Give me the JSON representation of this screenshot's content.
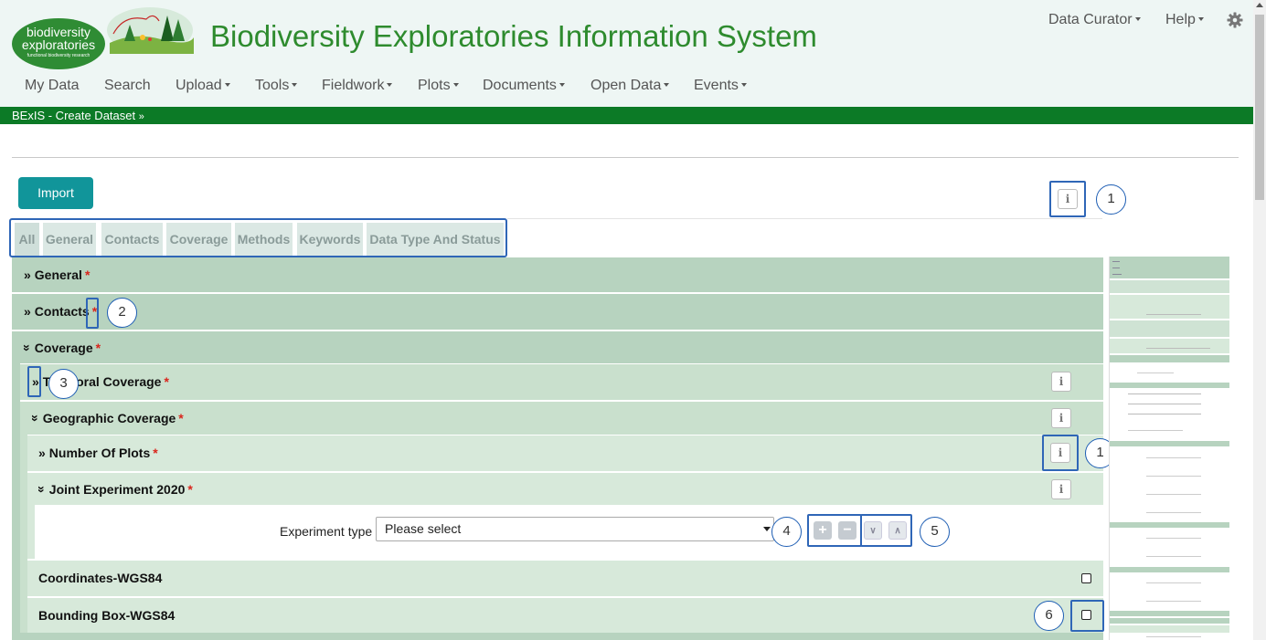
{
  "header": {
    "logo_line1": "biodiversity",
    "logo_line2": "exploratories",
    "logo_sub": "functional biodiversity research",
    "title": "Biodiversity Exploratories Information System",
    "user_menu": "Data Curator",
    "help_menu": "Help"
  },
  "nav": [
    {
      "label": "My Data",
      "dropdown": false
    },
    {
      "label": "Search",
      "dropdown": false
    },
    {
      "label": "Upload",
      "dropdown": true
    },
    {
      "label": "Tools",
      "dropdown": true
    },
    {
      "label": "Fieldwork",
      "dropdown": true
    },
    {
      "label": "Plots",
      "dropdown": true
    },
    {
      "label": "Documents",
      "dropdown": true
    },
    {
      "label": "Open Data",
      "dropdown": true
    },
    {
      "label": "Events",
      "dropdown": true
    }
  ],
  "breadcrumb": "BExIS - Create Dataset",
  "import_label": "Import",
  "tabs": [
    "All",
    "General",
    "Contacts",
    "Coverage",
    "Methods",
    "Keywords",
    "Data Type And Status"
  ],
  "sections": {
    "general": "General",
    "contacts": "Contacts",
    "coverage": "Coverage",
    "temporal": "Temporal Coverage",
    "geographic": "Geographic Coverage",
    "plots": "Number Of Plots",
    "joint": "Joint Experiment 2020",
    "coordinates": "Coordinates-WGS84",
    "bbox": "Bounding Box-WGS84"
  },
  "required_mark": "*",
  "experiment": {
    "label": "Experiment type",
    "value": "Please select"
  },
  "callouts": [
    "1",
    "2",
    "3",
    "1",
    "4",
    "5",
    "6"
  ],
  "colors": {
    "brand_green": "#0c7a26",
    "title_green": "#2e8b2e",
    "import_teal": "#11959a",
    "highlight_blue": "#2f66b7",
    "section_green": "#b7d3bf",
    "sub_green": "#c9e0cd"
  },
  "icons": [
    "gear-icon",
    "info-icon",
    "plus-icon",
    "minus-icon",
    "chevron-down-icon",
    "chevron-up-icon",
    "checkbox-icon"
  ]
}
